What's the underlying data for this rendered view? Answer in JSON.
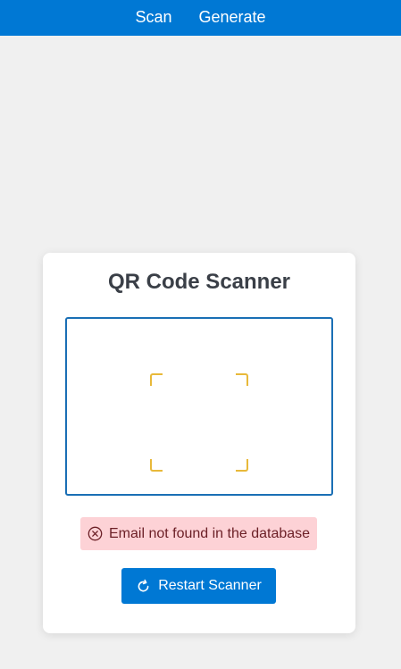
{
  "nav": {
    "items": [
      {
        "label": "Scan"
      },
      {
        "label": "Generate"
      }
    ]
  },
  "scanner": {
    "title": "QR Code Scanner",
    "error_message": "Email not found in the database",
    "restart_label": "Restart Scanner"
  },
  "icons": {
    "error": "circle-x-icon",
    "restart": "refresh-icon"
  },
  "colors": {
    "accent": "#0078d4",
    "scanner_border": "#1a6fb5",
    "scan_corners": "#e8b93a",
    "error_bg": "#fdd2d6",
    "error_text": "#6b1f26"
  }
}
